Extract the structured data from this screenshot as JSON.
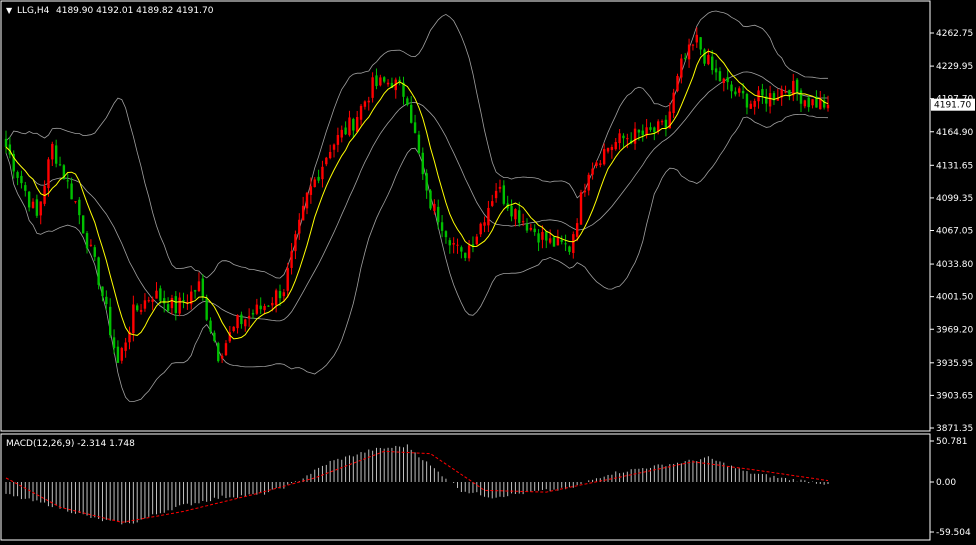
{
  "header": {
    "symbol_label": "LLG,H4",
    "ohlc_text": "4189.90 4192.01 4189.82 4191.70",
    "menu_glyph": "▼"
  },
  "price_panel": {
    "ticks": [
      "4262.75",
      "4229.95",
      "4197.70",
      "4164.90",
      "4131.65",
      "4099.35",
      "4067.05",
      "4033.80",
      "4001.50",
      "3969.20",
      "3935.95",
      "3903.65",
      "3871.35"
    ],
    "current_price_label": "4191.70"
  },
  "macd_panel": {
    "label": "MACD(12,26,9) -2.314 1.748",
    "ticks": [
      "50.781",
      "0.00",
      "-59.504"
    ]
  },
  "colors": {
    "background": "#000000",
    "bull": "#ff0000",
    "bear": "#00c000",
    "ma": "#ffff00",
    "bands": "#a0a0a0",
    "macd_hist": "#c0c0c0",
    "signal": "#ff0000",
    "axis": "#ffffff"
  },
  "chart_data": [
    {
      "type": "candlestick",
      "series_key_points": [
        {
          "i": 0,
          "close": 4150
        },
        {
          "i": 8,
          "close": 4080
        },
        {
          "i": 12,
          "close": 4150
        },
        {
          "i": 18,
          "close": 4095
        },
        {
          "i": 24,
          "close": 4020
        },
        {
          "i": 29,
          "close": 3935
        },
        {
          "i": 33,
          "close": 3985
        },
        {
          "i": 38,
          "close": 4005
        },
        {
          "i": 44,
          "close": 3990
        },
        {
          "i": 50,
          "close": 4012
        },
        {
          "i": 55,
          "close": 3945
        },
        {
          "i": 60,
          "close": 3975
        },
        {
          "i": 66,
          "close": 3990
        },
        {
          "i": 72,
          "close": 4010
        },
        {
          "i": 78,
          "close": 4100
        },
        {
          "i": 84,
          "close": 4150
        },
        {
          "i": 90,
          "close": 4175
        },
        {
          "i": 95,
          "close": 4210
        },
        {
          "i": 100,
          "close": 4215
        },
        {
          "i": 104,
          "close": 4200
        },
        {
          "i": 109,
          "close": 4100
        },
        {
          "i": 113,
          "close": 4075
        },
        {
          "i": 118,
          "close": 4040
        },
        {
          "i": 122,
          "close": 4065
        },
        {
          "i": 127,
          "close": 4110
        },
        {
          "i": 131,
          "close": 4090
        },
        {
          "i": 136,
          "close": 4070
        },
        {
          "i": 141,
          "close": 4055
        },
        {
          "i": 146,
          "close": 4050
        },
        {
          "i": 151,
          "close": 4130
        },
        {
          "i": 156,
          "close": 4150
        },
        {
          "i": 161,
          "close": 4160
        },
        {
          "i": 166,
          "close": 4162
        },
        {
          "i": 171,
          "close": 4170
        },
        {
          "i": 175,
          "close": 4230
        },
        {
          "i": 179,
          "close": 4255
        },
        {
          "i": 183,
          "close": 4225
        },
        {
          "i": 188,
          "close": 4205
        },
        {
          "i": 193,
          "close": 4195
        },
        {
          "i": 198,
          "close": 4200
        },
        {
          "i": 203,
          "close": 4210
        },
        {
          "i": 208,
          "close": 4195
        },
        {
          "i": 213,
          "close": 4191.7
        }
      ],
      "bar_count": 214,
      "ylim": [
        3871.35,
        4275
      ],
      "overlays": [
        "moving-average",
        "bollinger-bands"
      ]
    },
    {
      "type": "bar",
      "name": "MACD(12,26,9)",
      "ylim": [
        -59.504,
        50.781
      ],
      "histogram_key_points": [
        {
          "i": 0,
          "v": -15
        },
        {
          "i": 12,
          "v": -28
        },
        {
          "i": 24,
          "v": -45
        },
        {
          "i": 32,
          "v": -50
        },
        {
          "i": 44,
          "v": -30
        },
        {
          "i": 56,
          "v": -18
        },
        {
          "i": 66,
          "v": -15
        },
        {
          "i": 74,
          "v": -3
        },
        {
          "i": 84,
          "v": 25
        },
        {
          "i": 95,
          "v": 40
        },
        {
          "i": 104,
          "v": 45
        },
        {
          "i": 110,
          "v": 20
        },
        {
          "i": 118,
          "v": -10
        },
        {
          "i": 126,
          "v": -18
        },
        {
          "i": 136,
          "v": -12
        },
        {
          "i": 146,
          "v": -8
        },
        {
          "i": 156,
          "v": 10
        },
        {
          "i": 166,
          "v": 18
        },
        {
          "i": 176,
          "v": 25
        },
        {
          "i": 182,
          "v": 30
        },
        {
          "i": 192,
          "v": 12
        },
        {
          "i": 202,
          "v": 4
        },
        {
          "i": 213,
          "v": -2.314
        }
      ],
      "signal_key_points": [
        {
          "i": 0,
          "v": 5
        },
        {
          "i": 14,
          "v": -30
        },
        {
          "i": 30,
          "v": -48
        },
        {
          "i": 46,
          "v": -35
        },
        {
          "i": 64,
          "v": -15
        },
        {
          "i": 80,
          "v": 5
        },
        {
          "i": 98,
          "v": 38
        },
        {
          "i": 110,
          "v": 35
        },
        {
          "i": 124,
          "v": -10
        },
        {
          "i": 140,
          "v": -12
        },
        {
          "i": 158,
          "v": 5
        },
        {
          "i": 178,
          "v": 25
        },
        {
          "i": 194,
          "v": 15
        },
        {
          "i": 213,
          "v": 1.748
        }
      ]
    }
  ]
}
